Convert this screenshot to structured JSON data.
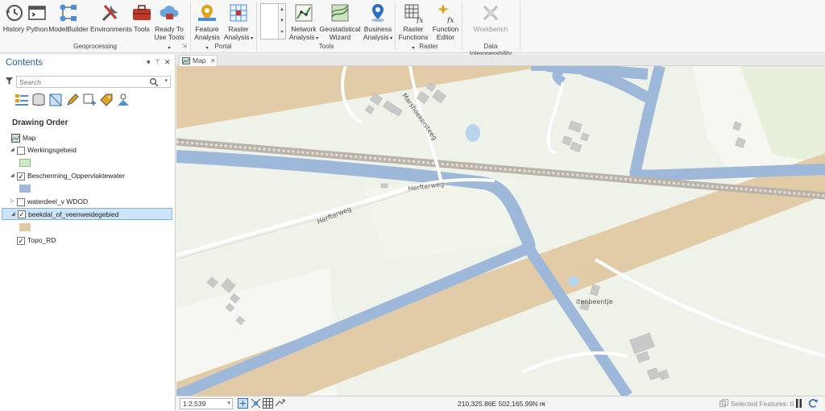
{
  "ribbon": {
    "geoprocessing": {
      "group_label": "Geoprocessing",
      "items": [
        {
          "label": "History",
          "icon": "history-icon"
        },
        {
          "label": "Python",
          "icon": "python-icon"
        },
        {
          "label": "ModelBuilder",
          "icon": "modelbuilder-icon"
        },
        {
          "label": "Environments",
          "icon": "environments-icon"
        },
        {
          "label": "Tools",
          "icon": "toolbox-icon"
        },
        {
          "label": "Ready To",
          "label2": "Use Tools",
          "icon": "ready-to-use-tools-icon"
        }
      ]
    },
    "portal": {
      "group_label": "Portal",
      "items": [
        {
          "label": "Feature",
          "label2": "Analysis",
          "icon": "feature-analysis-icon"
        },
        {
          "label": "Raster",
          "label2": "Analysis",
          "icon": "raster-analysis-icon"
        }
      ]
    },
    "tools": {
      "group_label": "Tools",
      "items": [
        {
          "label": "Network",
          "label2": "Analysis",
          "icon": "network-analysis-icon"
        },
        {
          "label": "Geostatistical",
          "label2": "Wizard",
          "icon": "geostatistical-wizard-icon"
        },
        {
          "label": "Business",
          "label2": "Analysis",
          "icon": "business-analysis-icon"
        }
      ]
    },
    "raster": {
      "group_label": "Raster",
      "items": [
        {
          "label": "Raster",
          "label2": "Functions",
          "icon": "raster-functions-icon"
        },
        {
          "label": "Function",
          "label2": "Editor",
          "icon": "function-editor-icon"
        }
      ]
    },
    "data_interop": {
      "group_label": "Data Interoperability",
      "items": [
        {
          "label": "Workbench",
          "icon": "workbench-icon",
          "disabled": true
        }
      ]
    }
  },
  "contents": {
    "title": "Contents",
    "search_placeholder": "Search",
    "drawing_order_label": "Drawing Order",
    "map_label": "Map",
    "layers": [
      {
        "name": "Werkingsgebeid",
        "checked": false,
        "expanded": true,
        "swatch": "#cfe8c6"
      },
      {
        "name": "Bescherming_Oppervlaktewater",
        "checked": true,
        "expanded": true,
        "swatch": "#9db8d9"
      },
      {
        "name": "waterdeel_v WDOD",
        "checked": false,
        "expanded": false
      },
      {
        "name": "beekdal_of_veenweidegebied",
        "checked": true,
        "expanded": true,
        "selected": true,
        "swatch": "#e0c9a3"
      },
      {
        "name": "Topo_RD",
        "checked": true,
        "expanded": false
      }
    ]
  },
  "map": {
    "tab_label": "Map",
    "labels": {
      "street1": "Marshoekersteeg",
      "street2": "Herfterweg",
      "street3": "Herfterweg",
      "place": "itenbeentje"
    },
    "colors": {
      "background": "#eef2e9",
      "water_buffer": "#9db8d9",
      "beekdal": "#e0c9a3",
      "railway": "#b9b3aa",
      "building": "#c9c9c9"
    }
  },
  "status": {
    "scale": "1:2,539",
    "coordinates": "210,325.86E 502,165.99N m",
    "selected_features": "Selected Features: 0"
  }
}
